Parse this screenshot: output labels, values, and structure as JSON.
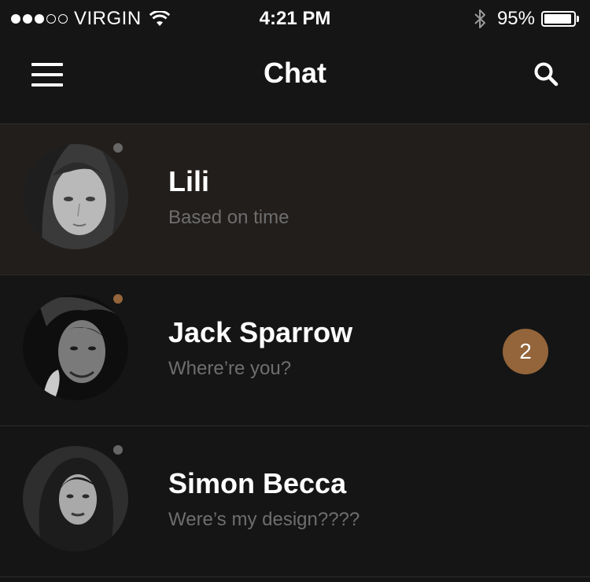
{
  "status_bar": {
    "carrier": "VIRGIN",
    "signal_bars": 3,
    "signal_total": 5,
    "time": "4:21 PM",
    "battery_percent": "95%",
    "battery_level": 0.95
  },
  "nav": {
    "title": "Chat",
    "menu_icon": "hamburger-menu-icon",
    "search_icon": "search-icon"
  },
  "colors": {
    "background": "#151515",
    "selected_row": "#221e1c",
    "accent": "#94643a",
    "presence_offline": "#666666",
    "preview_text": "#6e6e6e"
  },
  "chats": [
    {
      "name": "Lili",
      "preview": "Based on time",
      "status": "offline",
      "unread": "",
      "selected": true
    },
    {
      "name": "Jack Sparrow",
      "preview": "Where’re you?",
      "status": "online",
      "unread": "2",
      "selected": false
    },
    {
      "name": "Simon Becca",
      "preview": "Were’s my design????",
      "status": "offline",
      "unread": "",
      "selected": false
    }
  ]
}
